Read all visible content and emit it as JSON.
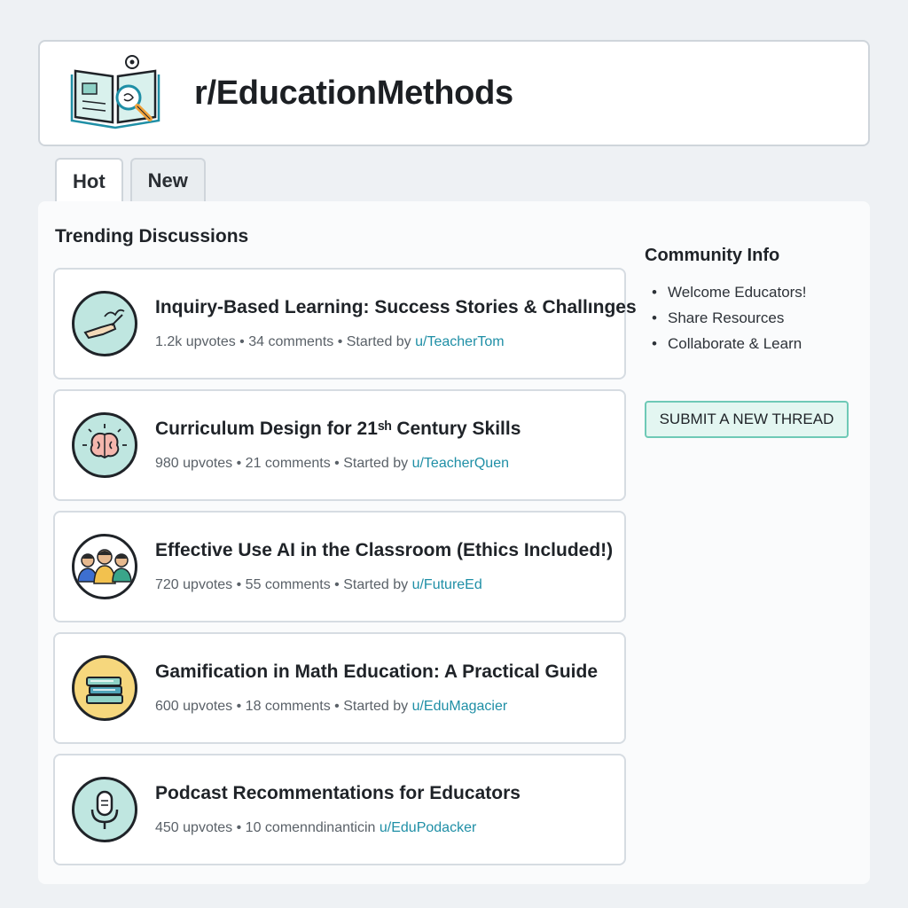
{
  "header": {
    "title": "r/EducationMethods",
    "logo_icon": "open-book-magnifier-icon"
  },
  "tabs": [
    {
      "label": "Hot",
      "active": true
    },
    {
      "label": "New",
      "active": false
    }
  ],
  "main": {
    "section_title": "Trending Discussions",
    "posts": [
      {
        "title": "Inquiry-Based Learning: Success Stories & Challınges",
        "meta_prefix": "1.2k upvotes • 34 comments • Started by ",
        "author": "u/TeacherTom",
        "icon": "hand-drawing-icon",
        "icon_bg": "#bfe6e0"
      },
      {
        "title": "Curriculum Design for 21ˢʰ Century Skills",
        "meta_prefix": "980 upvotes • 21 comments • Started by ",
        "author": "u/TeacherQuen",
        "icon": "brain-icon",
        "icon_bg": "#bfe6e0"
      },
      {
        "title": "Effective Use AI in the Classroom (Ethics Included!)",
        "meta_prefix": "720 upvotes • 55 comments • Started by ",
        "author": "u/FutureEd",
        "icon": "people-group-icon",
        "icon_bg": "#ffffff"
      },
      {
        "title": "Gamification in Math Education: A Practical Guide",
        "meta_prefix": "600 upvotes • 18 comments  • Started by ",
        "author": "u/EduMagacier",
        "icon": "books-stack-icon",
        "icon_bg": "#f6d77d"
      },
      {
        "title": "Podcast Recommentations for Educators",
        "meta_prefix": "450 upvotes • 10 comenndinanticin ",
        "author": "u/EduPodacker",
        "icon": "microphone-icon",
        "icon_bg": "#bfe6e0"
      }
    ]
  },
  "sidebar": {
    "title": "Community Info",
    "items": [
      "Welcome Educators!",
      "Share Resources",
      "Collaborate & Learn"
    ],
    "submit_label": "SUBMIT A NEW THREAD"
  },
  "colors": {
    "accent": "#1f8fa6",
    "button_bg": "#e3f6f1",
    "button_border": "#6ec9b6"
  }
}
